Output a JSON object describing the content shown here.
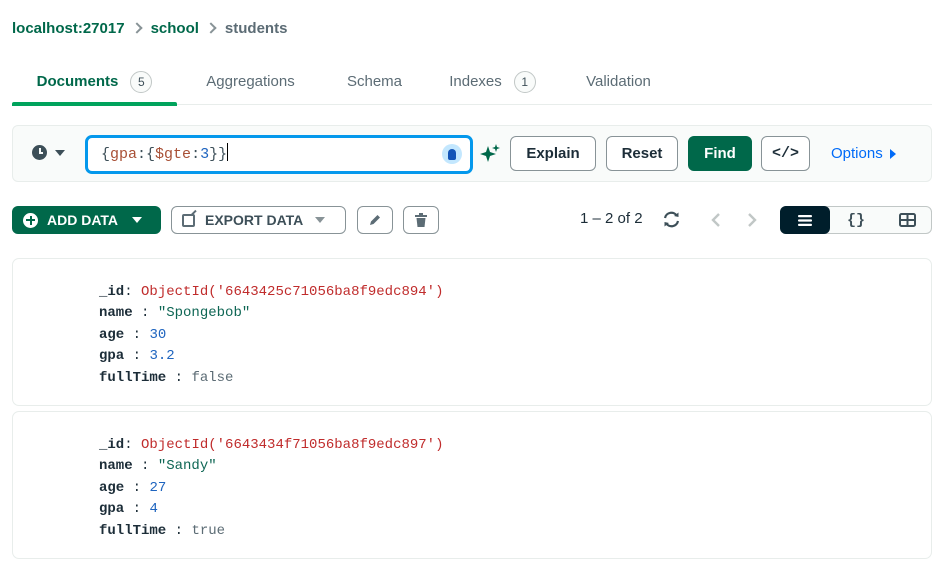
{
  "breadcrumb": {
    "host": "localhost:27017",
    "database": "school",
    "collection": "students"
  },
  "tabs": [
    {
      "label": "Documents",
      "badge": "5",
      "active": true
    },
    {
      "label": "Aggregations"
    },
    {
      "label": "Schema"
    },
    {
      "label": "Indexes",
      "badge": "1"
    },
    {
      "label": "Validation"
    }
  ],
  "query": {
    "open_brace": "{",
    "key": "gpa",
    "inner_open": ":{",
    "operator": "$gte",
    "colon": ":",
    "value": "3",
    "close": "}}",
    "explain_label": "Explain",
    "reset_label": "Reset",
    "find_label": "Find",
    "code_label": "</>",
    "options_label": "Options"
  },
  "toolbar": {
    "add_data_label": "ADD DATA",
    "export_data_label": "EXPORT DATA",
    "pagination": "1 – 2 of 2",
    "json_view_label": "{}"
  },
  "documents": [
    {
      "id_value": "ObjectId('6643425c71056ba8f9edc894')",
      "name": "\"Spongebob\"",
      "age": "30",
      "gpa": "3.2",
      "fullTime": "false"
    },
    {
      "id_value": "ObjectId('6643434f71056ba8f9edc897')",
      "name": "\"Sandy\"",
      "age": "27",
      "gpa": "4",
      "fullTime": "true"
    }
  ],
  "field_names": {
    "id": "_id",
    "name": "name",
    "age": "age",
    "gpa": "gpa",
    "fullTime": "fullTime"
  },
  "colors": {
    "brand_green": "#00684a",
    "accent_blue": "#0498ec",
    "link_blue": "#016bf8",
    "oid_red": "#c02c2c"
  },
  "icons": [
    "clock-icon",
    "lightbulb-icon",
    "sparkle-icon",
    "plus-icon",
    "export-icon",
    "pencil-icon",
    "trash-icon",
    "refresh-icon",
    "chevron-left-icon",
    "chevron-right-icon",
    "list-view-icon",
    "table-view-icon"
  ]
}
